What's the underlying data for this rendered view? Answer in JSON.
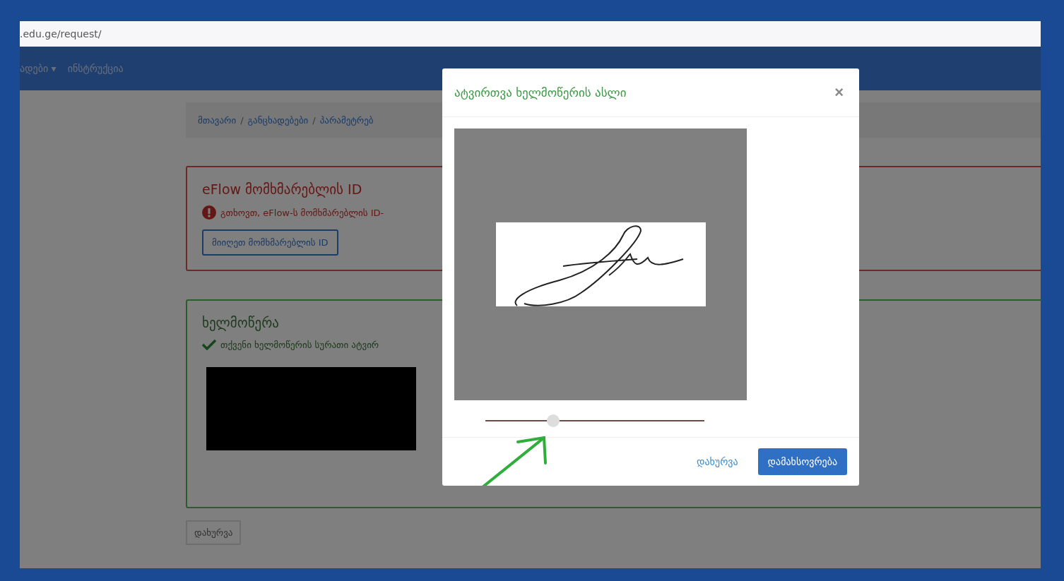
{
  "address_bar": {
    "url": ".edu.ge/request/"
  },
  "navbar": {
    "items": [
      {
        "label": "ადები",
        "caret": "▾"
      },
      {
        "label": "ინსტრუქცია"
      }
    ]
  },
  "breadcrumb": [
    {
      "label": "მთავარი",
      "separator": "/"
    },
    {
      "label": "განცხადებები",
      "separator": "/"
    },
    {
      "label": "პარამეტრებ"
    }
  ],
  "eflow_card": {
    "title": "eFlow მომხმარებლის ID",
    "error": "გთხოვთ, eFlow-ს მომხმარებლის ID-",
    "button": "მიიღეთ მომხმარებლის ID"
  },
  "signature_card": {
    "title": "ხელმოწერა",
    "message": "თქვენი ხელმოწერის სურათი ატვირ"
  },
  "close_button": "დახურვა",
  "modal": {
    "title": "ატვირთვა ხელმოწერის ასლი",
    "close": "×",
    "zoom_slider": {
      "level": 0.31
    },
    "cancel": "დახურვა",
    "save": "დამახსოვრება"
  }
}
